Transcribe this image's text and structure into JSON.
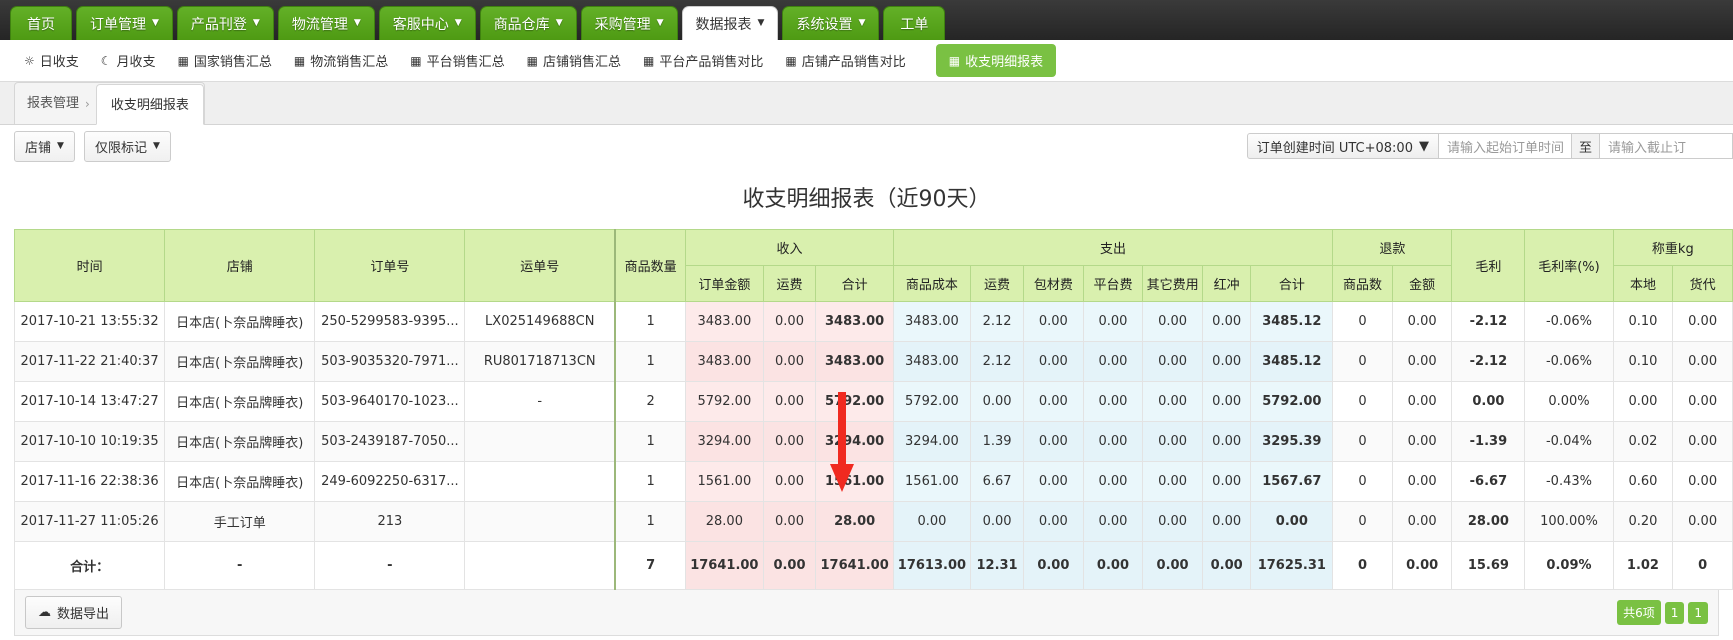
{
  "topnav": {
    "items": [
      {
        "label": "首页",
        "caret": false,
        "active": false
      },
      {
        "label": "订单管理",
        "caret": true,
        "active": false
      },
      {
        "label": "产品刊登",
        "caret": true,
        "active": false
      },
      {
        "label": "物流管理",
        "caret": true,
        "active": false
      },
      {
        "label": "客服中心",
        "caret": true,
        "active": false
      },
      {
        "label": "商品仓库",
        "caret": true,
        "active": false
      },
      {
        "label": "采购管理",
        "caret": true,
        "active": false
      },
      {
        "label": "数据报表",
        "caret": true,
        "active": true
      },
      {
        "label": "系统设置",
        "caret": true,
        "active": false
      },
      {
        "label": "工单",
        "caret": false,
        "active": false
      }
    ]
  },
  "subnav": {
    "items": [
      {
        "label": "日收支",
        "icon": "sun-icon",
        "glyph": "☼",
        "active": false
      },
      {
        "label": "月收支",
        "icon": "moon-icon",
        "glyph": "☾",
        "active": false
      },
      {
        "label": "国家销售汇总",
        "icon": "grid-icon",
        "glyph": "▦",
        "active": false
      },
      {
        "label": "物流销售汇总",
        "icon": "grid-icon",
        "glyph": "▦",
        "active": false
      },
      {
        "label": "平台销售汇总",
        "icon": "grid-icon",
        "glyph": "▦",
        "active": false
      },
      {
        "label": "店铺销售汇总",
        "icon": "grid-icon",
        "glyph": "▦",
        "active": false
      },
      {
        "label": "平台产品销售对比",
        "icon": "grid-icon",
        "glyph": "▦",
        "active": false
      },
      {
        "label": "店铺产品销售对比",
        "icon": "grid-icon",
        "glyph": "▦",
        "active": false
      },
      {
        "label": "收支明细报表",
        "icon": "grid-icon",
        "glyph": "▦",
        "active": true
      }
    ]
  },
  "breadcrumb": {
    "root": "报表管理",
    "separator": "›",
    "tab": "收支明细报表"
  },
  "filters": {
    "shop_button": "店铺",
    "marked_button": "仅限标记",
    "caret": "▼",
    "date_type_label": "订单创建时间 UTC+08:00",
    "start_placeholder": "请输入起始订单时间",
    "between_label": "至",
    "end_placeholder": "请输入截止订"
  },
  "report": {
    "title": "收支明细报表（近90天）"
  },
  "table": {
    "group_headers": {
      "income": "收入",
      "expense": "支出",
      "refund": "退款",
      "weight": "称重kg"
    },
    "columns": [
      "时间",
      "店铺",
      "订单号",
      "运单号",
      "商品数量",
      "订单金额",
      "运费",
      "合计",
      "商品成本",
      "运费",
      "包材费",
      "平台费",
      "其它费用",
      "红冲",
      "合计",
      "商品数",
      "金额",
      "毛利",
      "毛利率(%)",
      "本地",
      "货代"
    ],
    "rows": [
      {
        "time": "2017-10-21 13:55:32",
        "shop": "日本店(卜奈品牌睡衣)",
        "order_no": "250-5299583-9395...",
        "tracking_no": "LX025149688CN",
        "qty": "1",
        "income_amount": "3483.00",
        "income_freight": "0.00",
        "income_total": "3483.00",
        "cost_goods": "3483.00",
        "cost_freight": "2.12",
        "cost_packing": "0.00",
        "cost_platform": "0.00",
        "cost_other": "0.00",
        "cost_redflush": "0.00",
        "cost_total": "3485.12",
        "refund_qty": "0",
        "refund_amount": "0.00",
        "gross_profit": "-2.12",
        "gross_rate": "-0.06%",
        "weight_local": "0.10",
        "weight_agent": "0.00"
      },
      {
        "time": "2017-11-22 21:40:37",
        "shop": "日本店(卜奈品牌睡衣)",
        "order_no": "503-9035320-7971...",
        "tracking_no": "RU801718713CN",
        "qty": "1",
        "income_amount": "3483.00",
        "income_freight": "0.00",
        "income_total": "3483.00",
        "cost_goods": "3483.00",
        "cost_freight": "2.12",
        "cost_packing": "0.00",
        "cost_platform": "0.00",
        "cost_other": "0.00",
        "cost_redflush": "0.00",
        "cost_total": "3485.12",
        "refund_qty": "0",
        "refund_amount": "0.00",
        "gross_profit": "-2.12",
        "gross_rate": "-0.06%",
        "weight_local": "0.10",
        "weight_agent": "0.00"
      },
      {
        "time": "2017-10-14 13:47:27",
        "shop": "日本店(卜奈品牌睡衣)",
        "order_no": "503-9640170-1023...",
        "tracking_no": "-",
        "qty": "2",
        "income_amount": "5792.00",
        "income_freight": "0.00",
        "income_total": "5792.00",
        "cost_goods": "5792.00",
        "cost_freight": "0.00",
        "cost_packing": "0.00",
        "cost_platform": "0.00",
        "cost_other": "0.00",
        "cost_redflush": "0.00",
        "cost_total": "5792.00",
        "refund_qty": "0",
        "refund_amount": "0.00",
        "gross_profit": "0.00",
        "gross_rate": "0.00%",
        "weight_local": "0.00",
        "weight_agent": "0.00"
      },
      {
        "time": "2017-10-10 10:19:35",
        "shop": "日本店(卜奈品牌睡衣)",
        "order_no": "503-2439187-7050...",
        "tracking_no": "",
        "qty": "1",
        "income_amount": "3294.00",
        "income_freight": "0.00",
        "income_total": "3294.00",
        "cost_goods": "3294.00",
        "cost_freight": "1.39",
        "cost_packing": "0.00",
        "cost_platform": "0.00",
        "cost_other": "0.00",
        "cost_redflush": "0.00",
        "cost_total": "3295.39",
        "refund_qty": "0",
        "refund_amount": "0.00",
        "gross_profit": "-1.39",
        "gross_rate": "-0.04%",
        "weight_local": "0.02",
        "weight_agent": "0.00"
      },
      {
        "time": "2017-11-16 22:38:36",
        "shop": "日本店(卜奈品牌睡衣)",
        "order_no": "249-6092250-6317...",
        "tracking_no": "",
        "qty": "1",
        "income_amount": "1561.00",
        "income_freight": "0.00",
        "income_total": "1561.00",
        "cost_goods": "1561.00",
        "cost_freight": "6.67",
        "cost_packing": "0.00",
        "cost_platform": "0.00",
        "cost_other": "0.00",
        "cost_redflush": "0.00",
        "cost_total": "1567.67",
        "refund_qty": "0",
        "refund_amount": "0.00",
        "gross_profit": "-6.67",
        "gross_rate": "-0.43%",
        "weight_local": "0.60",
        "weight_agent": "0.00"
      },
      {
        "time": "2017-11-27 11:05:26",
        "shop": "手工订单",
        "order_no": "213",
        "tracking_no": "",
        "qty": "1",
        "income_amount": "28.00",
        "income_freight": "0.00",
        "income_total": "28.00",
        "cost_goods": "0.00",
        "cost_freight": "0.00",
        "cost_packing": "0.00",
        "cost_platform": "0.00",
        "cost_other": "0.00",
        "cost_redflush": "0.00",
        "cost_total": "0.00",
        "refund_qty": "0",
        "refund_amount": "0.00",
        "gross_profit": "28.00",
        "gross_rate": "100.00%",
        "weight_local": "0.20",
        "weight_agent": "0.00"
      }
    ],
    "total_row": {
      "time": "合计：",
      "shop": "-",
      "order_no": "-",
      "tracking_no": "",
      "qty": "7",
      "income_amount": "17641.00",
      "income_freight": "0.00",
      "income_total": "17641.00",
      "cost_goods": "17613.00",
      "cost_freight": "12.31",
      "cost_packing": "0.00",
      "cost_platform": "0.00",
      "cost_other": "0.00",
      "cost_redflush": "0.00",
      "cost_total": "17625.31",
      "refund_qty": "0",
      "refund_amount": "0.00",
      "gross_profit": "15.69",
      "gross_rate": "0.09%",
      "weight_local": "1.02",
      "weight_agent": "0"
    }
  },
  "footer": {
    "export_label": "数据导出",
    "export_icon": "cloud-download-icon",
    "total_count": "共6项",
    "page_current": "1",
    "page_next": "1"
  },
  "annotation": {
    "arrow_color": "#f02a20"
  }
}
